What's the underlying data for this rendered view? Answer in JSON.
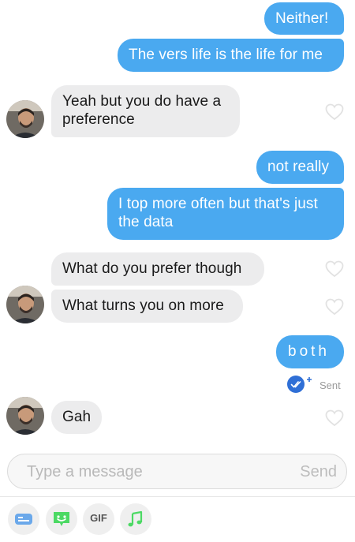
{
  "messages": [
    {
      "side": "out",
      "text": "Neither!"
    },
    {
      "side": "out",
      "text": "The vers life is the life for me"
    },
    {
      "side": "in",
      "line1": "Yeah but you do have a",
      "line2": "preference"
    },
    {
      "side": "out",
      "text": "not really"
    },
    {
      "side": "out",
      "line1": "I top more often but that's just",
      "line2": "the data"
    },
    {
      "side": "in",
      "text": "What do you prefer though"
    },
    {
      "side": "in",
      "text": "What turns you on more"
    },
    {
      "side": "out",
      "text": "both"
    },
    {
      "side": "in",
      "text": "Gah"
    }
  ],
  "status": {
    "sent": "Sent"
  },
  "composer": {
    "placeholder": "Type a message",
    "send_label": "Send"
  },
  "toolbar": {
    "gif_label": "GIF"
  },
  "colors": {
    "outgoing_bubble": "#4aa9f0",
    "incoming_bubble": "#ececed",
    "read_receipt": "#2f6fd6",
    "sticker_green": "#4cd964",
    "music_green": "#4cd964",
    "contact_blue": "#6aa8ea"
  },
  "icons": [
    "heart-icon",
    "read-receipt-icon",
    "contact-card-icon",
    "sticker-icon",
    "gif-icon",
    "music-note-icon"
  ]
}
